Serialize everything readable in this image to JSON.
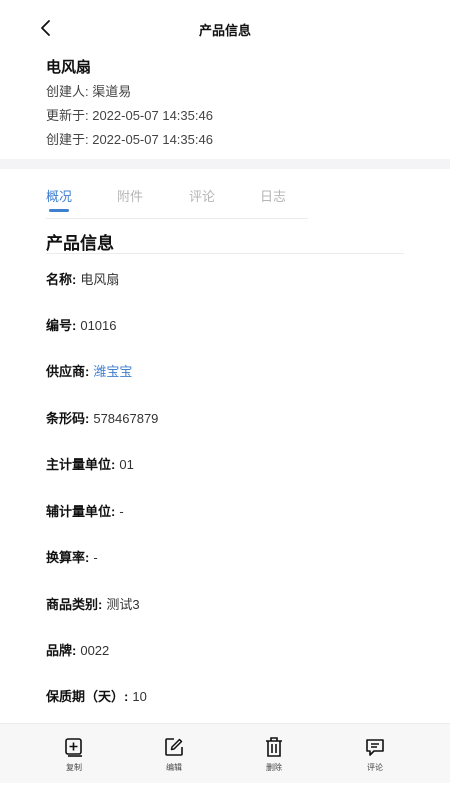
{
  "nav": {
    "title": "产品信息",
    "back_icon": "chevron-left-icon"
  },
  "product": {
    "name": "电风扇",
    "creator": "创建人: 渠道易",
    "updated": "更新于: 2022-05-07 14:35:46",
    "created": "创建于: 2022-05-07 14:35:46"
  },
  "tabs": [
    {
      "label": "概况",
      "active": true
    },
    {
      "label": "附件",
      "active": false
    },
    {
      "label": "评论",
      "active": false
    },
    {
      "label": "日志",
      "active": false
    }
  ],
  "section": {
    "title": "产品信息"
  },
  "fields": [
    {
      "label": "名称:",
      "value": "电风扇"
    },
    {
      "label": "编号:",
      "value": "01016"
    },
    {
      "label": "供应商:",
      "value": "潍宝宝",
      "link": true
    },
    {
      "label": "条形码:",
      "value": "578467879"
    },
    {
      "label": "主计量单位:",
      "value": "01"
    },
    {
      "label": "辅计量单位:",
      "value": "-"
    },
    {
      "label": "换算率:",
      "value": "-"
    },
    {
      "label": "商品类别:",
      "value": "测试3"
    },
    {
      "label": "品牌:",
      "value": "0022"
    },
    {
      "label": "保质期（天）:",
      "value": "10"
    }
  ],
  "toolbar": {
    "copy": {
      "label": "复制",
      "icon": "copy-plus-icon"
    },
    "edit": {
      "label": "编辑",
      "icon": "edit-icon"
    },
    "delete": {
      "label": "删除",
      "icon": "trash-icon"
    },
    "comment": {
      "label": "评论",
      "icon": "comment-icon"
    }
  },
  "colors": {
    "accent": "#3f7fd0",
    "divider": "#f4f4f6",
    "toolbar_bg": "#f7f7f7"
  }
}
